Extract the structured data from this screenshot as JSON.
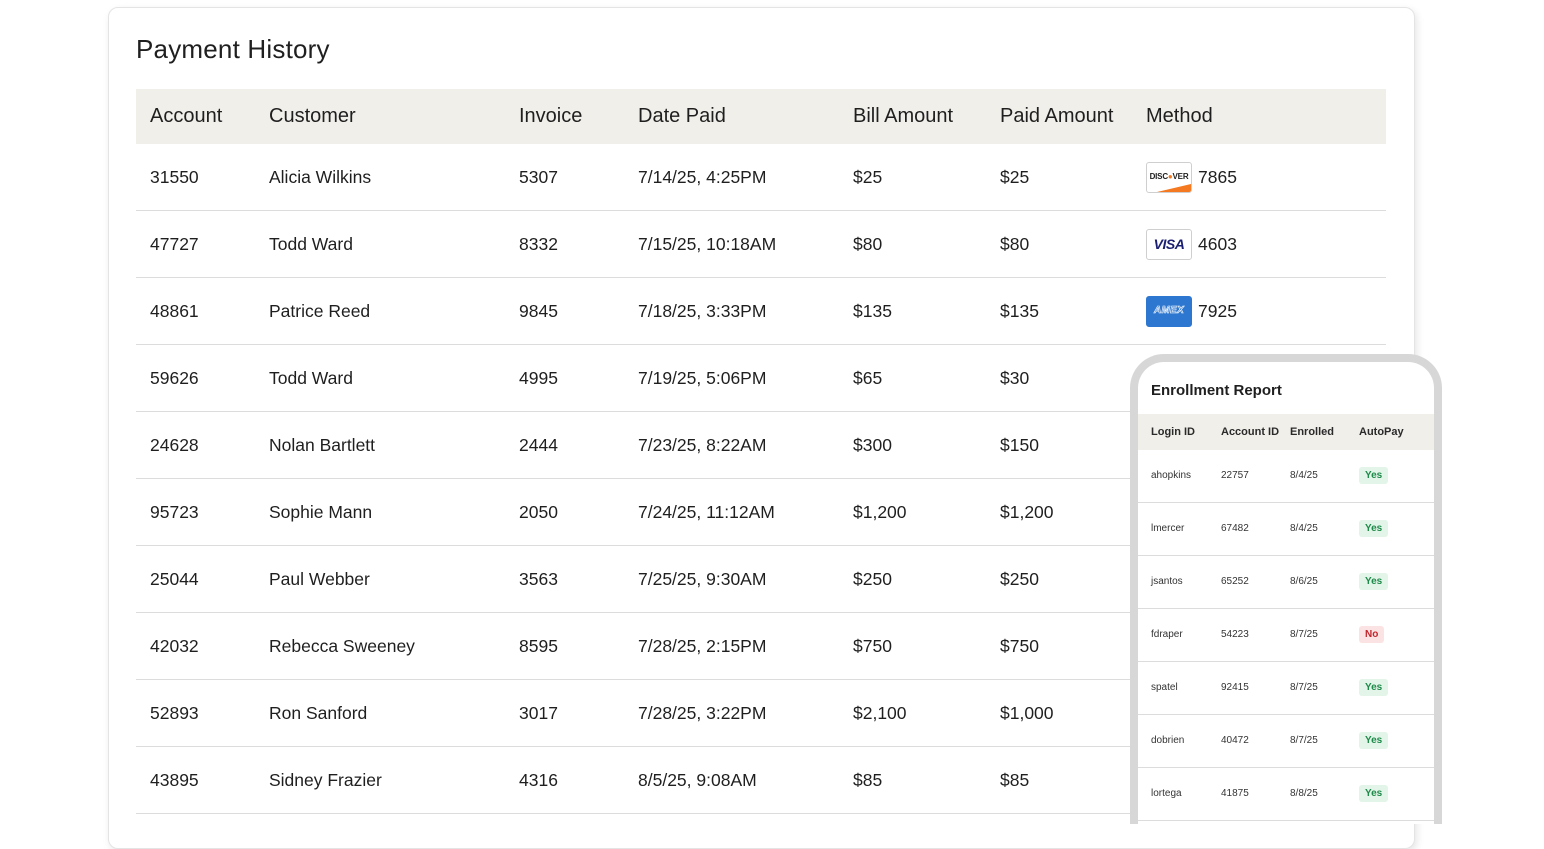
{
  "payment_history": {
    "title": "Payment History",
    "columns": [
      "Account",
      "Customer",
      "Invoice",
      "Date Paid",
      "Bill Amount",
      "Paid Amount",
      "Method"
    ],
    "rows": [
      {
        "account": "31550",
        "customer": "Alicia Wilkins",
        "invoice": "5307",
        "date_paid": "7/14/25, 4:25PM",
        "bill_amount": "$25",
        "paid_amount": "$25",
        "method_card": "discover",
        "method_card_label": "DISCOVER",
        "method_last4": "7865"
      },
      {
        "account": "47727",
        "customer": "Todd Ward",
        "invoice": "8332",
        "date_paid": "7/15/25, 10:18AM",
        "bill_amount": "$80",
        "paid_amount": "$80",
        "method_card": "visa",
        "method_card_label": "VISA",
        "method_last4": "4603"
      },
      {
        "account": "48861",
        "customer": "Patrice Reed",
        "invoice": "9845",
        "date_paid": "7/18/25, 3:33PM",
        "bill_amount": "$135",
        "paid_amount": "$135",
        "method_card": "amex",
        "method_card_label": "AMEX",
        "method_last4": "7925"
      },
      {
        "account": "59626",
        "customer": "Todd Ward",
        "invoice": "4995",
        "date_paid": "7/19/25, 5:06PM",
        "bill_amount": "$65",
        "paid_amount": "$30"
      },
      {
        "account": "24628",
        "customer": "Nolan Bartlett",
        "invoice": "2444",
        "date_paid": "7/23/25, 8:22AM",
        "bill_amount": "$300",
        "paid_amount": "$150"
      },
      {
        "account": "95723",
        "customer": "Sophie Mann",
        "invoice": "2050",
        "date_paid": "7/24/25, 11:12AM",
        "bill_amount": "$1,200",
        "paid_amount": "$1,200"
      },
      {
        "account": "25044",
        "customer": "Paul Webber",
        "invoice": "3563",
        "date_paid": "7/25/25, 9:30AM",
        "bill_amount": "$250",
        "paid_amount": "$250"
      },
      {
        "account": "42032",
        "customer": "Rebecca Sweeney",
        "invoice": "8595",
        "date_paid": "7/28/25, 2:15PM",
        "bill_amount": "$750",
        "paid_amount": "$750"
      },
      {
        "account": "52893",
        "customer": "Ron Sanford",
        "invoice": "3017",
        "date_paid": "7/28/25, 3:22PM",
        "bill_amount": "$2,100",
        "paid_amount": "$1,000"
      },
      {
        "account": "43895",
        "customer": "Sidney Frazier",
        "invoice": "4316",
        "date_paid": "8/5/25, 9:08AM",
        "bill_amount": "$85",
        "paid_amount": "$85"
      }
    ]
  },
  "enrollment_report": {
    "title": "Enrollment Report",
    "columns": [
      "Login ID",
      "Account ID",
      "Enrolled",
      "AutoPay"
    ],
    "rows": [
      {
        "login_id": "ahopkins",
        "account_id": "22757",
        "enrolled": "8/4/25",
        "autopay": "Yes"
      },
      {
        "login_id": "lmercer",
        "account_id": "67482",
        "enrolled": "8/4/25",
        "autopay": "Yes"
      },
      {
        "login_id": "jsantos",
        "account_id": "65252",
        "enrolled": "8/6/25",
        "autopay": "Yes"
      },
      {
        "login_id": "fdraper",
        "account_id": "54223",
        "enrolled": "8/7/25",
        "autopay": "No"
      },
      {
        "login_id": "spatel",
        "account_id": "92415",
        "enrolled": "8/7/25",
        "autopay": "Yes"
      },
      {
        "login_id": "dobrien",
        "account_id": "40472",
        "enrolled": "8/7/25",
        "autopay": "Yes"
      },
      {
        "login_id": "lortega",
        "account_id": "41875",
        "enrolled": "8/8/25",
        "autopay": "Yes"
      }
    ]
  },
  "colors": {
    "header_bg": "#f1efea",
    "yes_badge": "#1e8a4a",
    "no_badge": "#c0262d",
    "discover_orange": "#f47920",
    "visa_blue": "#1a1f71",
    "amex_blue": "#2e77d0"
  }
}
